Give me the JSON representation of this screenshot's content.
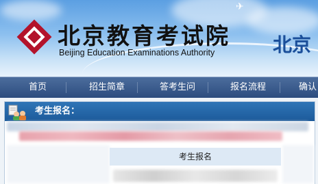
{
  "header": {
    "title_cn": "北京教育考试院",
    "title_en": "Beijing Education Examinations Authority",
    "right_text": "北京"
  },
  "nav": {
    "items": [
      {
        "label": "首页"
      },
      {
        "label": "招生简章"
      },
      {
        "label": "答考生问"
      },
      {
        "label": "报名流程"
      },
      {
        "label": "确认"
      }
    ]
  },
  "panel": {
    "title": "考生报名：",
    "table_header": "考生报名"
  },
  "colors": {
    "nav_bg": "#2c4c7e",
    "panel_head": "#1c5a9a",
    "logo_red": "#b3132b",
    "right_text": "#1b4f9a"
  },
  "icons": {
    "logo": "bjeea-logo-icon",
    "panel": "users-icon"
  }
}
